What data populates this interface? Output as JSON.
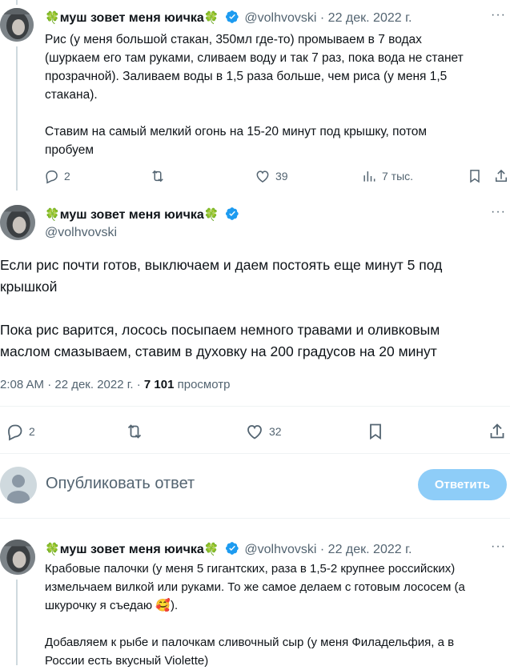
{
  "tweet1": {
    "name": "муш зовет меня юичка",
    "handle": "@volhvovski",
    "dot": "·",
    "date": "22 дек. 2022 г.",
    "lines": [
      "Рис (у меня большой стакан, 350мл где-то) промываем в 7 водах",
      "(шуркаем его там руками, сливаем воду и так 7 раз, пока вода не станет",
      "прозрачной). Заливаем воды в 1,5 раза больше, чем риса (у меня 1,5",
      "стакана).",
      "",
      "Ставим на самый мелкий огонь на 15-20 минут под крышку, потом",
      "пробуем"
    ],
    "replies": "2",
    "retweets": "",
    "likes": "39",
    "views": "7 тыс."
  },
  "tweet2": {
    "name": "муш зовет меня юичка",
    "handle": "@volhvovski",
    "lines": [
      "Если рис почти готов, выключаем и даем постоять еще минут 5 под",
      "крышкой",
      "",
      "Пока рис варится, лосось посыпаем немного травами и оливковым",
      "маслом смазываем, ставим в духовку на 200 градусов на 20 минут"
    ],
    "time": "2:08 AM · 22 дек. 2022 г. · ",
    "views_count": "7 101",
    "views_label": " просмотр",
    "replies": "2",
    "likes": "32"
  },
  "composer": {
    "placeholder": "Опубликовать ответ",
    "button": "Ответить"
  },
  "tweet3": {
    "name": "муш зовет меня юичка",
    "handle": "@volhvovski",
    "dot": "·",
    "date": "22 дек. 2022 г.",
    "lines": [
      "Крабовые палочки (у меня 5 гигантских, раза в 1,5-2 крупнее российских)",
      "измельчаем вилкой или руками. То же самое делаем с готовым лососем (а",
      "шкурочку я съедаю 🥰).",
      "",
      "Добавляем к рыбе и палочкам сливочный сыр (у меня Филадельфия, а в",
      "России есть вкусный Violette)"
    ]
  },
  "icons": {
    "clover": "🍀",
    "more": "···"
  },
  "colors": {
    "accent": "#1d9bf0",
    "muted": "#536471",
    "reply_button_disabled": "#8ecdf8",
    "clover": "#2e9b3a"
  }
}
